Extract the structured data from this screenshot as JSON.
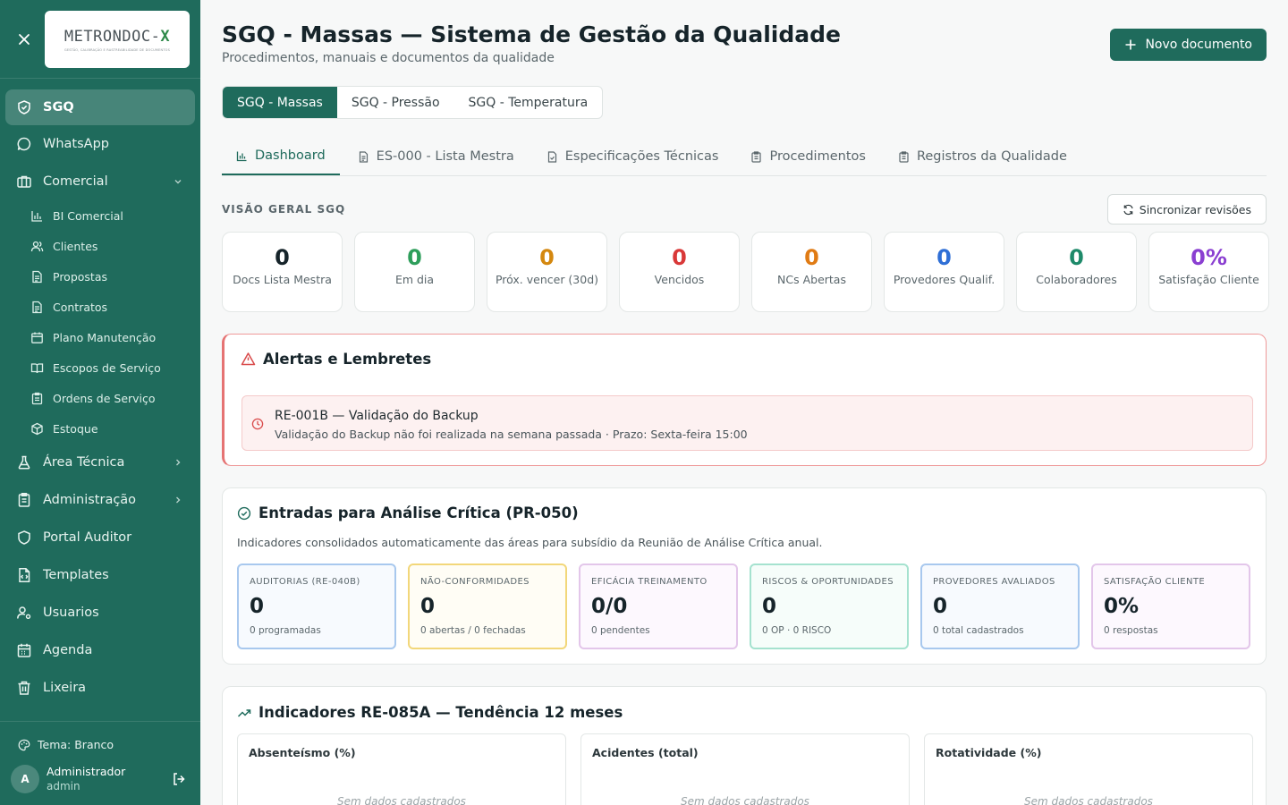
{
  "logo": {
    "main": "METR",
    "mid": "O",
    "main2": "NDOC-",
    "x": "X",
    "tagline": "GESTÃO, CALIBRAÇÃO E RASTREABILIDADE DE DOCUMENTOS"
  },
  "sidebar": {
    "items": [
      {
        "label": "SGQ"
      },
      {
        "label": "WhatsApp"
      },
      {
        "label": "Comercial"
      },
      {
        "label": "Área Técnica"
      },
      {
        "label": "Administração"
      },
      {
        "label": "Portal Auditor"
      },
      {
        "label": "Templates"
      },
      {
        "label": "Usuarios"
      },
      {
        "label": "Agenda"
      },
      {
        "label": "Lixeira"
      }
    ],
    "comercial_sub": [
      {
        "label": "BI Comercial"
      },
      {
        "label": "Clientes"
      },
      {
        "label": "Propostas"
      },
      {
        "label": "Contratos"
      },
      {
        "label": "Plano Manutenção"
      },
      {
        "label": "Escopos de Serviço"
      },
      {
        "label": "Ordens de Serviço"
      },
      {
        "label": "Estoque"
      }
    ],
    "theme": "Tema: Branco",
    "user": {
      "initial": "A",
      "name": "Administrador",
      "role": "admin"
    }
  },
  "header": {
    "title": "SGQ - Massas — Sistema de Gestão da Qualidade",
    "subtitle": "Procedimentos, manuais e documentos da qualidade",
    "new_button": "Novo documento"
  },
  "segments": [
    "SGQ - Massas",
    "SGQ - Pressão",
    "SGQ - Temperatura"
  ],
  "tabs": [
    "Dashboard",
    "ES-000 - Lista Mestra",
    "Especificações Técnicas",
    "Procedimentos",
    "Registros da Qualidade"
  ],
  "overview": {
    "label": "VISÃO GERAL SGQ",
    "sync_button": "Sincronizar revisões",
    "stats": [
      {
        "value": "0",
        "label": "Docs Lista Mestra",
        "color": "#16242a"
      },
      {
        "value": "0",
        "label": "Em dia",
        "color": "#2e9e5b"
      },
      {
        "value": "0",
        "label": "Próx. vencer (30d)",
        "color": "#d4880f"
      },
      {
        "value": "0",
        "label": "Vencidos",
        "color": "#d93838"
      },
      {
        "value": "0",
        "label": "NCs Abertas",
        "color": "#e07b14"
      },
      {
        "value": "0",
        "label": "Provedores Qualif.",
        "color": "#2f6fd6"
      },
      {
        "value": "0",
        "label": "Colaboradores",
        "color": "#1e8a6a"
      },
      {
        "value": "0%",
        "label": "Satisfação Cliente",
        "color": "#8a3fd1"
      }
    ]
  },
  "alerts": {
    "title": "Alertas e Lembretes",
    "items": [
      {
        "heading": "RE-001B — Validação do Backup",
        "detail": "Validação do Backup não foi realizada na semana passada · Prazo: Sexta-feira 15:00"
      }
    ]
  },
  "critical": {
    "title": "Entradas para Análise Crítica (PR-050)",
    "description": "Indicadores consolidados automaticamente das áreas para subsídio da Reunião de Análise Crítica anual.",
    "kpis": [
      {
        "label": "AUDITORIAS (RE-040B)",
        "value": "0",
        "sub": "0 programadas",
        "border": "#a8c8ee",
        "bg": "#f7fafe"
      },
      {
        "label": "NÃO-CONFORMIDADES",
        "value": "0",
        "sub": "0 abertas / 0 fechadas",
        "border": "#f2d77a",
        "bg": "#fffdf5"
      },
      {
        "label": "EFICÁCIA TREINAMENTO",
        "value": "0/0",
        "sub": "0 pendentes",
        "border": "#e3c6ea",
        "bg": "#fdf8fe"
      },
      {
        "label": "RISCOS & OPORTUNIDADES",
        "value": "0",
        "sub": "0 OP · 0 RISCO",
        "border": "#a5e2cf",
        "bg": "#f6fdfa"
      },
      {
        "label": "PROVEDORES AVALIADOS",
        "value": "0",
        "sub": "0 total cadastrados",
        "border": "#a8c8ee",
        "bg": "#f7fafe"
      },
      {
        "label": "SATISFAÇÃO CLIENTE",
        "value": "0%",
        "sub": "0 respostas",
        "border": "#e3c6ea",
        "bg": "#fdf8fe"
      }
    ]
  },
  "indicators": {
    "title": "Indicadores RE-085A — Tendência 12 meses",
    "panels": [
      {
        "name": "Absenteísmo (%)",
        "empty": "Sem dados cadastrados"
      },
      {
        "name": "Acidentes (total)",
        "empty": "Sem dados cadastrados"
      },
      {
        "name": "Rotatividade (%)",
        "empty": "Sem dados cadastrados"
      }
    ]
  }
}
